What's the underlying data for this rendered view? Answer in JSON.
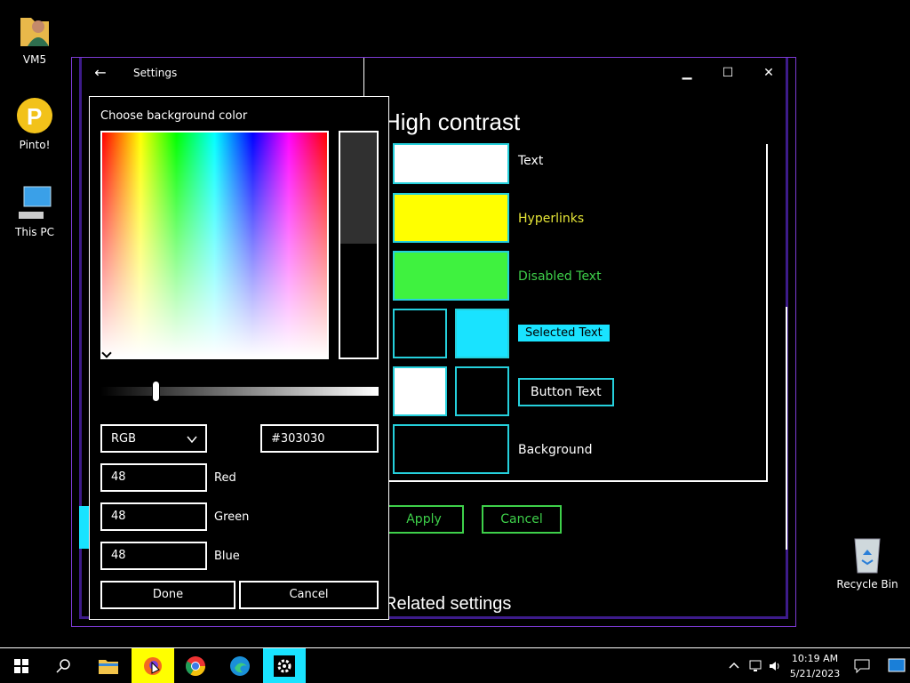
{
  "desktop": {
    "icons": [
      {
        "label": "VM5",
        "icon": "user-folder-icon"
      },
      {
        "label": "Pinto!",
        "icon": "pinto-app-icon"
      },
      {
        "label": "This PC",
        "icon": "computer-icon"
      }
    ],
    "recycle_bin": {
      "label": "Recycle Bin",
      "icon": "recycle-bin-icon"
    }
  },
  "window": {
    "app_title": "Settings",
    "back_glyph": "←",
    "minimize_glyph": "▁",
    "maximize_glyph": "☐",
    "close_glyph": "✕",
    "page_title": "High contrast",
    "rows": {
      "text": "Text",
      "hyperlinks": "Hyperlinks",
      "disabled": "Disabled Text",
      "selected": "Selected Text",
      "button": "Button Text",
      "background": "Background"
    },
    "apply_label": "Apply",
    "cancel_label": "Cancel",
    "related_title": "Related settings"
  },
  "colors": {
    "text": "#ffffff",
    "hyperlinks": "#ffff00",
    "disabled": "#3ff23f",
    "selected_bg": "#19e3ff",
    "button_bg": "#ffffff",
    "accent_border": "#25d0dc",
    "picked": "#303030"
  },
  "dialog": {
    "title": "Choose background color",
    "mode": "RGB",
    "hex": "#303030",
    "red_label": "Red",
    "red": "48",
    "green_label": "Green",
    "green": "48",
    "blue_label": "Blue",
    "blue": "48",
    "done_label": "Done",
    "cancel_label": "Cancel"
  },
  "taskbar": {
    "time": "10:19 AM",
    "date": "5/21/2023",
    "apps": [
      "start-icon",
      "search-icon",
      "file-explorer-icon",
      "firefox-icon",
      "chrome-icon",
      "edge-icon",
      "settings-icon"
    ]
  }
}
